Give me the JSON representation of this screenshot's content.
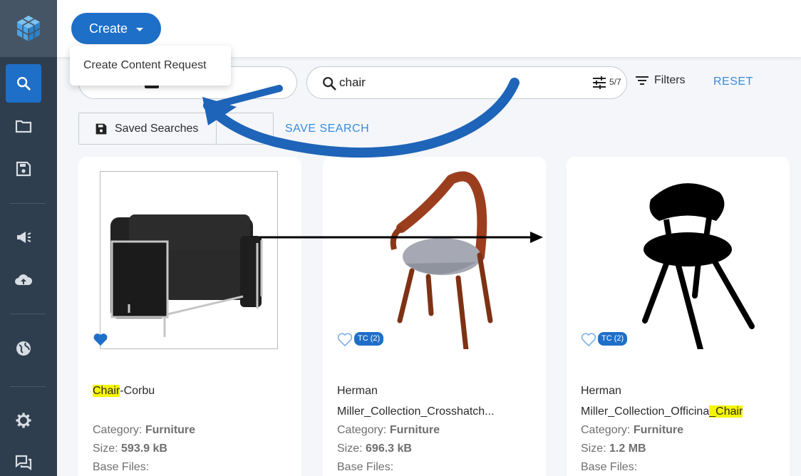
{
  "sidebar": {
    "logo": "cube-logo",
    "items": [
      {
        "icon": "search-icon",
        "active": true
      },
      {
        "icon": "folder-icon"
      },
      {
        "icon": "save-icon"
      },
      {
        "icon": "megaphone-icon"
      },
      {
        "icon": "cloud-upload-icon"
      },
      {
        "icon": "globe-icon"
      },
      {
        "icon": "gear-icon"
      },
      {
        "icon": "chat-icon"
      }
    ]
  },
  "topbar": {
    "create_label": "Create"
  },
  "create_menu": {
    "items": [
      "Create Content Request"
    ]
  },
  "search": {
    "left_pill_peek": "s",
    "value": "chair",
    "result_counter": "5/7",
    "filters_label": "Filters",
    "reset_label": "RESET"
  },
  "saved_searches": {
    "label": "Saved Searches",
    "save_label": "SAVE SEARCH"
  },
  "cards": [
    {
      "name_highlight": "Chair",
      "name_rest": "-Corbu",
      "category_label": "Category:",
      "category": "Furniture",
      "size_label": "Size:",
      "size": "593.9 kB",
      "base_files_label": "Base Files:",
      "favorite": true
    },
    {
      "name_line1": "Herman",
      "name_line2": "Miller_Collection_Crosshatch...",
      "category_label": "Category:",
      "category": "Furniture",
      "size_label": "Size:",
      "size": "696.3 kB",
      "base_files_label": "Base Files:",
      "favorite": false,
      "badge": "TC (2)"
    },
    {
      "name_line1": "Herman",
      "name_line2_plain": "Miller_Collection_Officina",
      "name_line2_highlight": "_Chair",
      "category_label": "Category:",
      "category": "Furniture",
      "size_label": "Size:",
      "size": "1.2 MB",
      "base_files_label": "Base Files:",
      "favorite": false,
      "badge": "TC (2)"
    }
  ],
  "colors": {
    "accent": "#1e6fc8",
    "sidebar": "#2f3e4e",
    "highlight": "#f5f500",
    "link": "#3a8ad8"
  }
}
